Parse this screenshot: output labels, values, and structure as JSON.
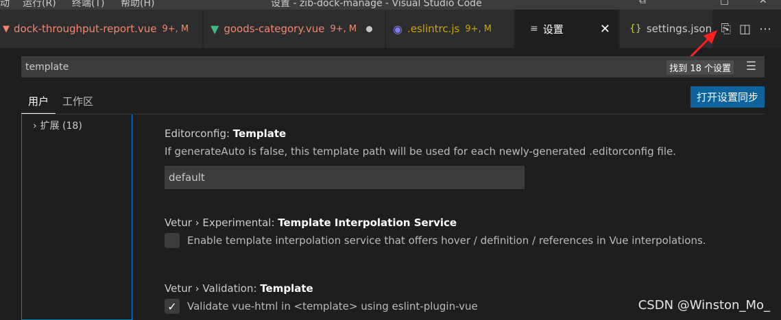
{
  "titlebar": {
    "menu_items": [
      "运行(R)",
      "终端(T)",
      "帮助(H)"
    ],
    "title": "设置 - zib-dock-manage - Visual Studio Code"
  },
  "tabs": [
    {
      "label": "dock-throughput-report.vue",
      "status": "9+, M",
      "icon": "vue-icon",
      "color": "#f48771"
    },
    {
      "label": "goods-category.vue",
      "status": "9+, M",
      "icon": "vue-icon",
      "color": "#f48771"
    },
    {
      "label": ".eslintrc.js",
      "status": "9+, M",
      "icon": "eslint-icon",
      "color": "#cca700"
    },
    {
      "label": "设置",
      "status": "",
      "icon": "settings-list-icon",
      "color": "#ffffff"
    },
    {
      "label": "settings.json",
      "status": "",
      "icon": "json-braces-icon",
      "color": "#cccccc"
    }
  ],
  "search": {
    "value": "template",
    "result_count": "找到 18 个设置"
  },
  "scope_tabs": [
    "用户",
    "工作区"
  ],
  "sync_button": "打开设置同步",
  "tree": {
    "item_label": "扩展 (18)"
  },
  "settings": [
    {
      "category": "Editorconfig: ",
      "name": "Template",
      "description": "If generateAuto is false, this template path will be used for each newly-generated .editorconfig file.",
      "value": "default"
    },
    {
      "category": "Vetur › Experimental: ",
      "name": "Template Interpolation Service",
      "description": "Enable template interpolation service that offers hover / definition / references in Vue interpolations.",
      "checked": false
    },
    {
      "category": "Vetur › Validation: ",
      "name": "Template",
      "description": "Validate vue-html in <template> using eslint-plugin-vue",
      "checked": true
    }
  ],
  "watermark": "CSDN @Winston_Mo_",
  "colors": {
    "accent": "#0e639c",
    "tree_focus": "#007fd4",
    "annotation_arrow": "#ff2020"
  }
}
